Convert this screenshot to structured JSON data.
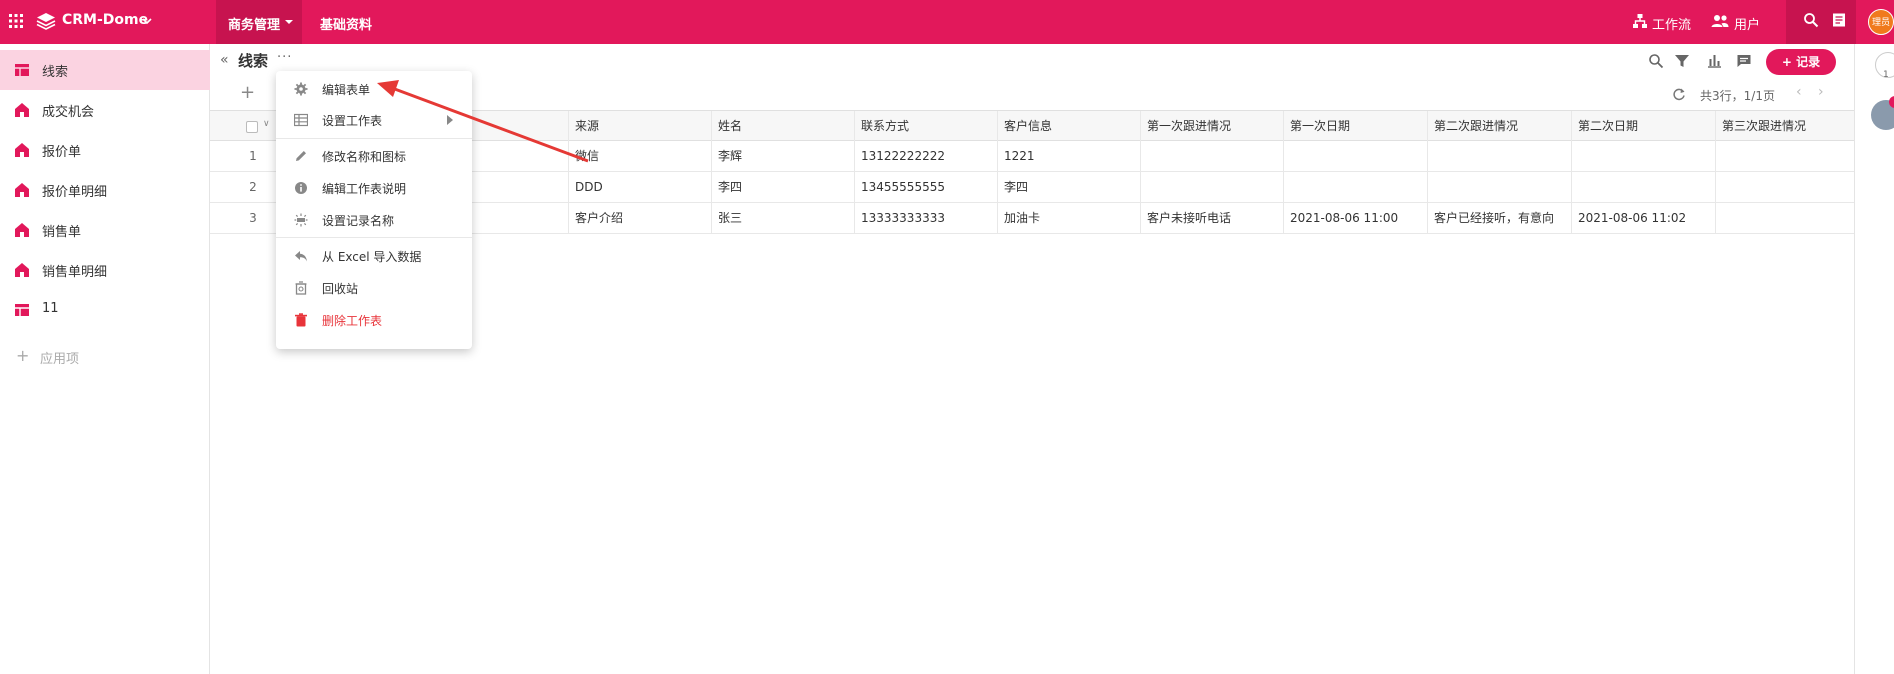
{
  "topbar": {
    "app_name": "CRM-Dome",
    "nav": [
      "商务管理",
      "基础资料"
    ],
    "workflow_label": "工作流",
    "user_label": "用户",
    "avatar_text": "理员"
  },
  "sidebar": {
    "items": [
      {
        "label": "线索",
        "icon": "table-icon"
      },
      {
        "label": "成交机会",
        "icon": "home-icon"
      },
      {
        "label": "报价单",
        "icon": "home-icon"
      },
      {
        "label": "报价单明细",
        "icon": "home-icon"
      },
      {
        "label": "销售单",
        "icon": "home-icon"
      },
      {
        "label": "销售单明细",
        "icon": "home-icon"
      },
      {
        "label": "11",
        "icon": "table-icon"
      }
    ],
    "add_label": "应用项"
  },
  "sheet": {
    "title": "线索",
    "more": "···",
    "add_record_label": "+ 记录",
    "pager": "共3行，1/1页",
    "prev": "‹",
    "next": "›"
  },
  "rail": {
    "bell_count": "1"
  },
  "table": {
    "headers": [
      "来源",
      "姓名",
      "联系方式",
      "客户信息",
      "第一次跟进情况",
      "第一次日期",
      "第二次跟进情况",
      "第二次日期",
      "第三次跟进情况"
    ],
    "rows": [
      {
        "num": "1",
        "cells": [
          "微信",
          "李辉",
          "13122222222",
          "1221",
          "",
          "",
          "",
          "",
          ""
        ]
      },
      {
        "num": "2",
        "cells": [
          "DDD",
          "李四",
          "13455555555",
          "李四",
          "",
          "",
          "",
          "",
          ""
        ]
      },
      {
        "num": "3",
        "cells": [
          "客户介绍",
          "张三",
          "13333333333",
          "加油卡",
          "客户未接听电话",
          "2021-08-06 11:00",
          "客户已经接听，有意向",
          "2021-08-06 11:02",
          ""
        ]
      }
    ]
  },
  "menu": {
    "items": [
      {
        "label": "编辑表单",
        "icon": "gear-icon"
      },
      {
        "label": "设置工作表",
        "icon": "table-grid-icon"
      },
      {
        "label": "修改名称和图标",
        "icon": "pencil-icon"
      },
      {
        "label": "编辑工作表说明",
        "icon": "info-icon"
      },
      {
        "label": "设置记录名称",
        "icon": "sparkle-icon"
      },
      {
        "label": "从 Excel 导入数据",
        "icon": "reply-icon"
      },
      {
        "label": "回收站",
        "icon": "recycle-icon"
      },
      {
        "label": "删除工作表",
        "icon": "trash-icon"
      }
    ]
  },
  "colors": {
    "brand": "#e2185b",
    "brand_dark": "#c7134f",
    "sidebar_active": "#fbd3e1",
    "danger": "#e8343a",
    "annotation_arrow": "#e53935"
  }
}
